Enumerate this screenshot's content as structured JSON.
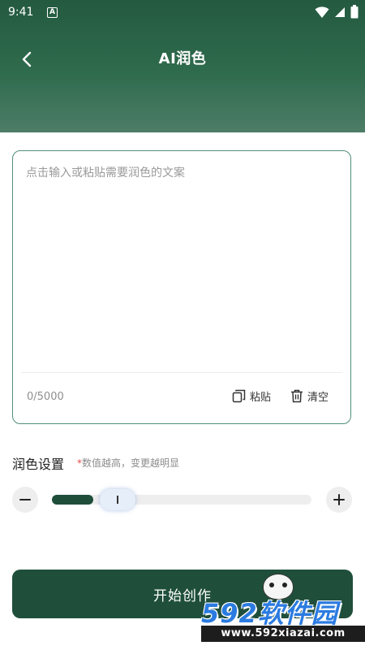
{
  "status_bar": {
    "time": "9:41",
    "notification_icon": "A"
  },
  "header": {
    "title": "AI润色",
    "back_icon": "chevron-left-icon"
  },
  "editor": {
    "placeholder": "点击输入或粘贴需要润色的文案",
    "value": "",
    "counter": "0/5000",
    "paste_label": "粘贴",
    "clear_label": "清空"
  },
  "settings": {
    "title": "润色设置",
    "hint_star": "*",
    "hint": "数值越高，变更越明显",
    "slider_level": 0.19
  },
  "start_button": {
    "label": "开始创作"
  },
  "watermark": {
    "main": "592软件园",
    "sub": "www.592xiazai.com"
  },
  "colors": {
    "brand": "#1f4f3b",
    "border": "#4f8f7c",
    "header_top": "#245a40",
    "header_bottom": "#4d7d67"
  }
}
